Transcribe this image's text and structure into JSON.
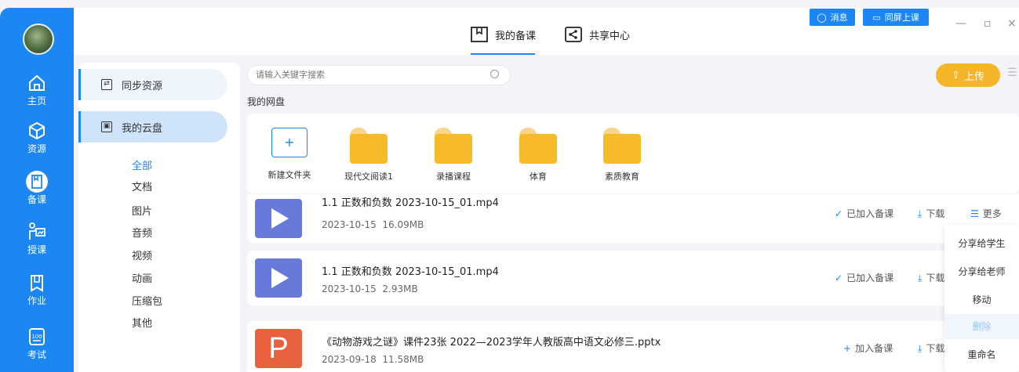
{
  "nav": [
    {
      "label": "主页",
      "icon": "home-icon"
    },
    {
      "label": "资源",
      "icon": "cube-icon"
    },
    {
      "label": "备课",
      "icon": "book-icon"
    },
    {
      "label": "授课",
      "icon": "teach-icon"
    },
    {
      "label": "作业",
      "icon": "homework-icon"
    },
    {
      "label": "考试",
      "icon": "exam-icon"
    }
  ],
  "header": {
    "tab_lesson": "我的备课",
    "tab_share": "共享中心",
    "msg_label": "消息",
    "screen_label": "同屏上课"
  },
  "side": {
    "sync": "同步资源",
    "cloud": "我的云盘",
    "cats": [
      "全部",
      "文档",
      "图片",
      "音频",
      "视频",
      "动画",
      "压缩包",
      "其他"
    ]
  },
  "search": {
    "placeholder": "请输入关键字搜索"
  },
  "breadcrumb": "我的网盘",
  "upload_label": "上传",
  "folders": [
    "新建文件夹",
    "现代文阅读1",
    "录播课程",
    "体育",
    "素质教育"
  ],
  "files": [
    {
      "name": "1.1 正数和负数 2023-10-15_01.mp4",
      "date": "2023-10-15",
      "size": "16.09MB",
      "status": "已加入备课",
      "download": "下载",
      "more": "更多"
    },
    {
      "name": "1.1 正数和负数 2023-10-15_01.mp4",
      "date": "2023-10-15",
      "size": "2.93MB",
      "status": "已加入备课",
      "download": "下载"
    },
    {
      "name": "《动物游戏之谜》课件23张 2022—2023学年人教版高中语文必修三.pptx",
      "date": "2023-09-18",
      "size": "11.58MB",
      "status": "加入备课",
      "download": "下载"
    }
  ],
  "ppt_letter": "P",
  "menu": [
    "分享给学生",
    "分享给老师",
    "移动",
    "删除",
    "重命名"
  ]
}
